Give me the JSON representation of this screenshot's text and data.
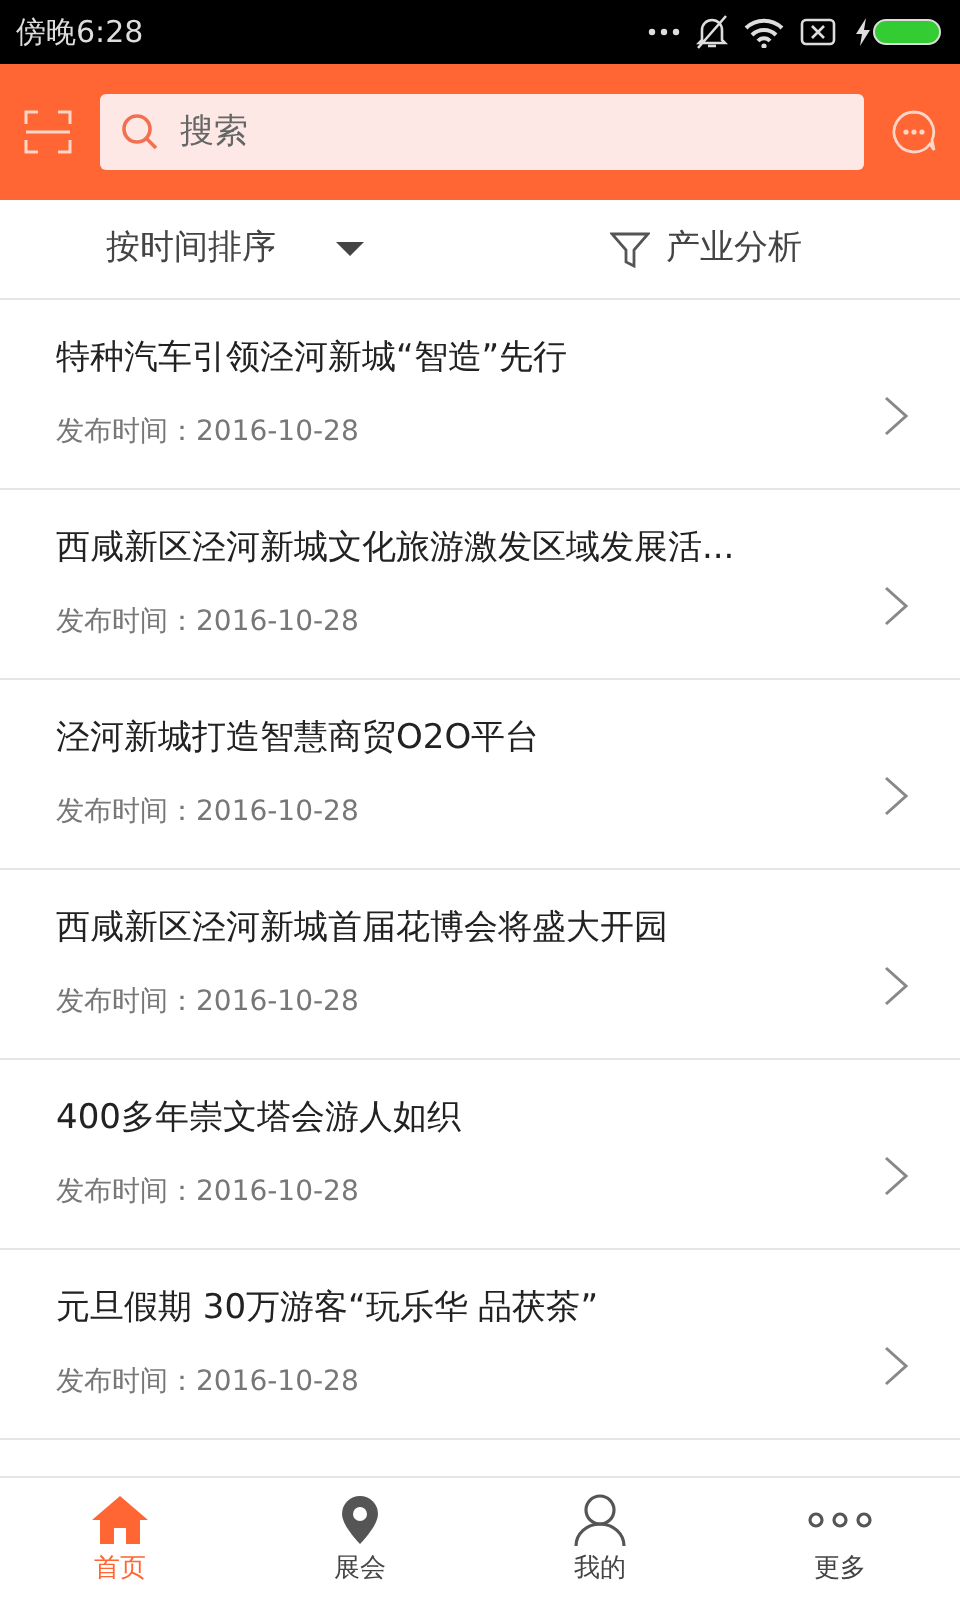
{
  "status_bar": {
    "time": "傍晚6:28"
  },
  "header": {
    "search": {
      "placeholder": "搜索"
    }
  },
  "filter_bar": {
    "sort": "按时间排序",
    "analysis": "产业分析"
  },
  "news": [
    {
      "title": "特种汽车引领泾河新城“智造”先行",
      "date": "发布时间：2016-10-28"
    },
    {
      "title": "西咸新区泾河新城文化旅游激发区域发展活...",
      "date": "发布时间：2016-10-28"
    },
    {
      "title": "泾河新城打造智慧商贸O2O平台",
      "date": "发布时间：2016-10-28"
    },
    {
      "title": "西咸新区泾河新城首届花博会将盛大开园",
      "date": "发布时间：2016-10-28"
    },
    {
      "title": "400多年崇文塔会游人如织",
      "date": "发布时间：2016-10-28"
    },
    {
      "title": "元旦假期 30万游客“玩乐华 品茯茶”",
      "date": "发布时间：2016-10-28"
    }
  ],
  "tab_bar": [
    {
      "label": "首页",
      "kind": "home",
      "selected": true
    },
    {
      "label": "展会",
      "kind": "pin",
      "selected": false
    },
    {
      "label": "我的",
      "kind": "person",
      "selected": false
    },
    {
      "label": "更多",
      "kind": "more",
      "selected": false
    }
  ]
}
